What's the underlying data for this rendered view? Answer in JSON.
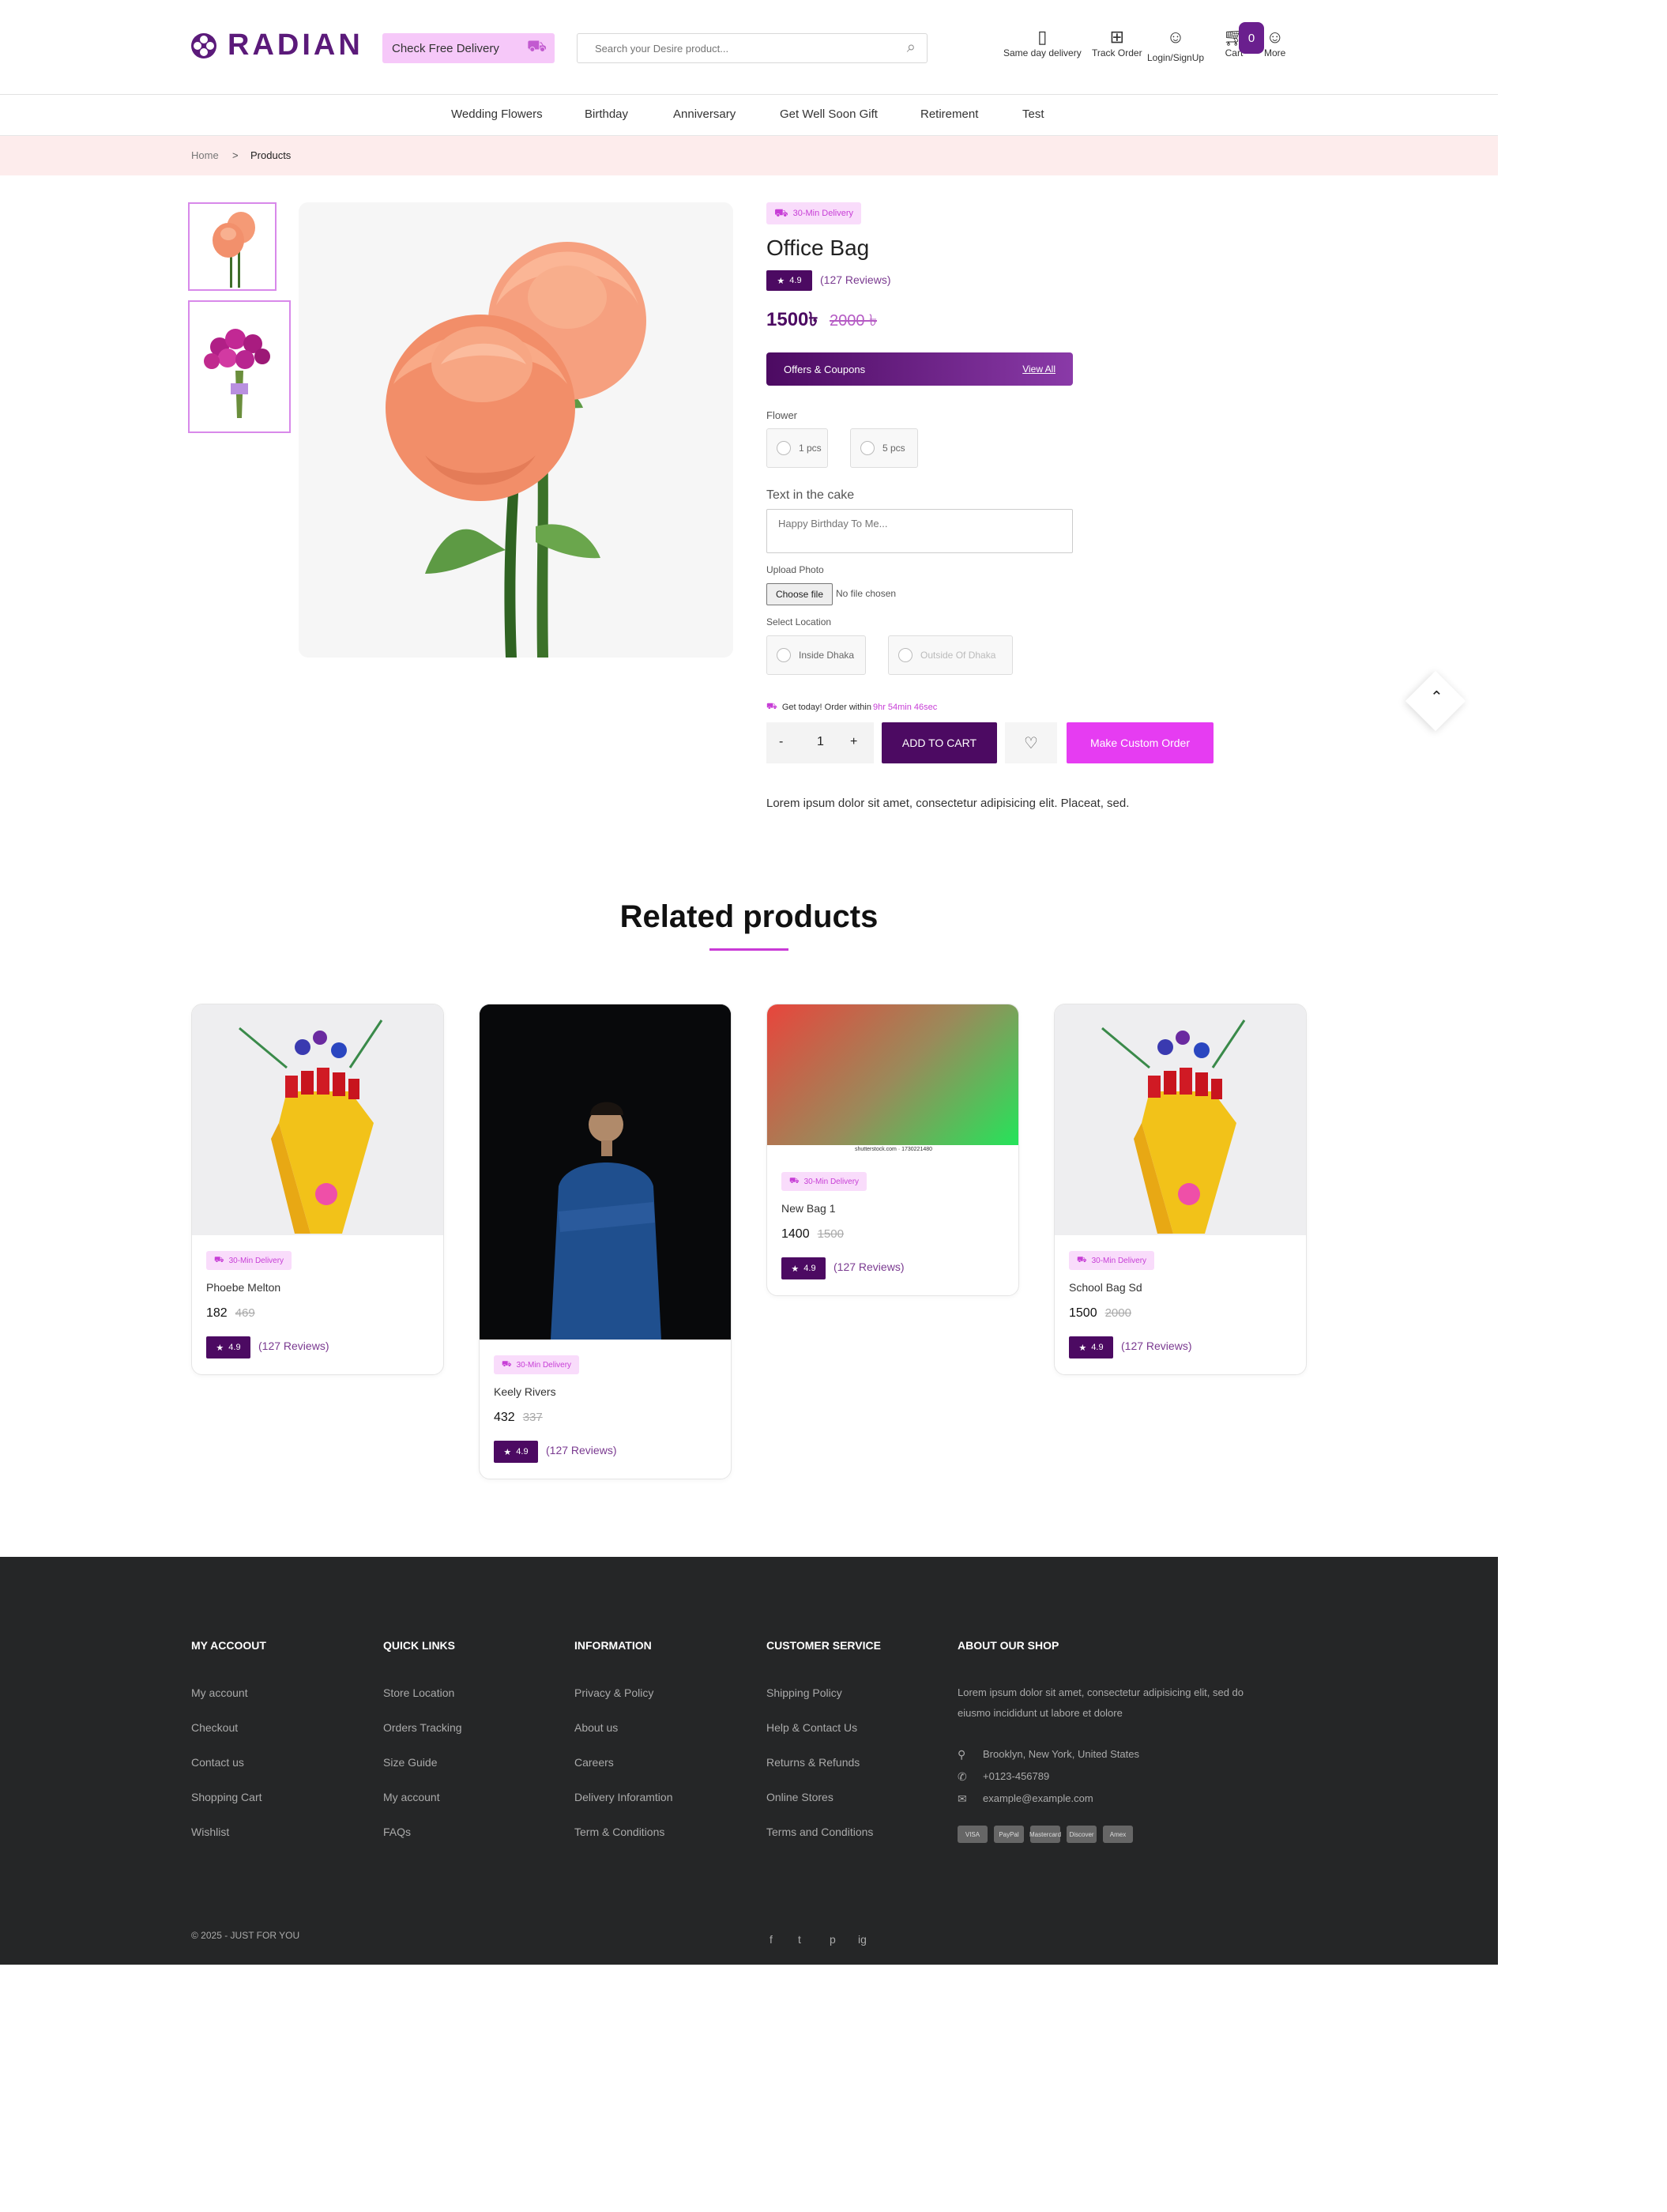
{
  "header": {
    "brand": "RADIAN",
    "free_delivery": "Check Free Delivery",
    "search_placeholder": "Search your Desire product...",
    "same_day": "Same day delivery",
    "track": "Track Order",
    "login": "Login/SignUp",
    "cart": "Cart",
    "cart_count": "0",
    "more": "More"
  },
  "nav": [
    "Wedding Flowers",
    "Birthday",
    "Anniversary",
    "Get Well Soon Gift",
    "Retirement",
    "Test"
  ],
  "breadcrumb": {
    "home": "Home",
    "separator": ">",
    "current": "Products"
  },
  "product": {
    "delivery_badge": "30-Min Delivery",
    "title": "Office Bag",
    "rating": "4.9",
    "reviews": "(127 Reviews)",
    "price": "1500৳",
    "old_price": "2000 ৳",
    "offers_label": "Offers & Coupons",
    "view_all": "View All",
    "flower_label": "Flower",
    "flower_options": [
      "1 pcs",
      "5 pcs"
    ],
    "text_label": "Text in the cake",
    "text_placeholder": "Happy Birthday To Me...",
    "upload_label": "Upload Photo",
    "file_button": "Choose file",
    "file_status": "No file chosen",
    "location_label": "Select Location",
    "location_options": [
      "Inside Dhaka",
      "Outside Of Dhaka"
    ],
    "timer_text": "Get today! Order within",
    "timer_value": "9hr 54min 46sec",
    "qty_minus": "-",
    "qty": "1",
    "qty_plus": "+",
    "add_to_cart": "ADD TO CART",
    "custom_order": "Make Custom Order",
    "description": "Lorem ipsum dolor sit amet, consectetur adipisicing elit. Placeat, sed."
  },
  "related": {
    "title": "Related products",
    "items": [
      {
        "badge": "30-Min Delivery",
        "name": "Phoebe Melton",
        "price": "182",
        "old_price": "469",
        "rating": "4.9",
        "reviews": "(127 Reviews)"
      },
      {
        "badge": "30-Min Delivery",
        "name": "Keely Rivers",
        "price": "432",
        "old_price": "337",
        "rating": "4.9",
        "reviews": "(127 Reviews)"
      },
      {
        "badge": "30-Min Delivery",
        "name": "New Bag 1",
        "price": "1400",
        "old_price": "1500",
        "rating": "4.9",
        "reviews": "(127 Reviews)",
        "image_caption": "shutterstock.com · 1730221480"
      },
      {
        "badge": "30-Min Delivery",
        "name": "School Bag Sd",
        "price": "1500",
        "old_price": "2000",
        "rating": "4.9",
        "reviews": "(127 Reviews)"
      }
    ]
  },
  "footer": {
    "columns": [
      {
        "title": "MY ACCOOUT",
        "links": [
          "My account",
          "Checkout",
          "Contact us",
          "Shopping Cart",
          "Wishlist"
        ]
      },
      {
        "title": "QUICK LINKS",
        "links": [
          "Store Location",
          "Orders Tracking",
          "Size Guide",
          "My account",
          "FAQs"
        ]
      },
      {
        "title": "INFORMATION",
        "links": [
          "Privacy & Policy",
          "About us",
          "Careers",
          "Delivery Inforamtion",
          "Term & Conditions"
        ]
      },
      {
        "title": "CUSTOMER SERVICE",
        "links": [
          "Shipping Policy",
          "Help & Contact Us",
          "Returns & Refunds",
          "Online Stores",
          "Terms and Conditions"
        ]
      }
    ],
    "about_title": "ABOUT OUR SHOP",
    "about_line1": "Lorem ipsum dolor sit amet, consectetur adipisicing elit, sed do",
    "about_line2": "eiusmo incididunt ut labore et dolore",
    "address": "Brooklyn, New York, United States",
    "phone": "+0123-456789",
    "email": "example@example.com",
    "payments": [
      "VISA",
      "PayPal",
      "Mastercard",
      "Discover",
      "Amex"
    ],
    "copyright": "© 2025 - JUST FOR YOU",
    "social": [
      "f",
      "t",
      "p",
      "ig"
    ]
  },
  "colors": {
    "brand": "#4c0a62",
    "accent": "#e63cf2",
    "badge_bg": "#f9dcfb",
    "footer_bg": "#252627"
  }
}
